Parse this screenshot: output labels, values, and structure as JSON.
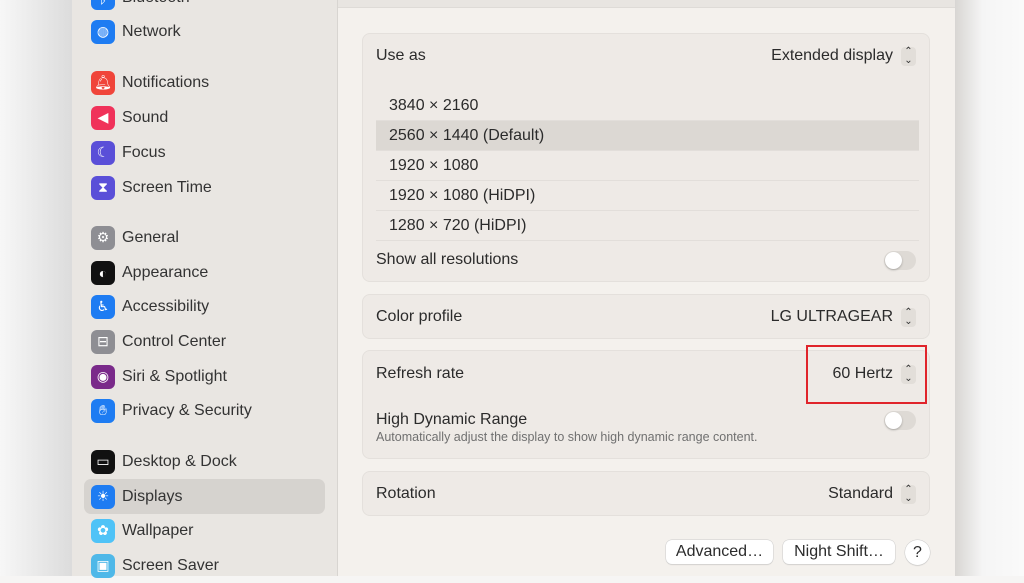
{
  "sidebar": {
    "items": [
      {
        "label": "Bluetooth",
        "icon": "bluetooth-icon",
        "color": "#1e7cf2"
      },
      {
        "label": "Network",
        "icon": "globe-icon",
        "color": "#1e7cf2"
      },
      {
        "label": "Notifications",
        "icon": "bell-icon",
        "color": "#f0453a"
      },
      {
        "label": "Sound",
        "icon": "speaker-icon",
        "color": "#f0325a"
      },
      {
        "label": "Focus",
        "icon": "moon-icon",
        "color": "#5a4fd8"
      },
      {
        "label": "Screen Time",
        "icon": "hourglass-icon",
        "color": "#5a4fd8"
      },
      {
        "label": "General",
        "icon": "gear-icon",
        "color": "#8e8e93"
      },
      {
        "label": "Appearance",
        "icon": "appearance-icon",
        "color": "#111111"
      },
      {
        "label": "Accessibility",
        "icon": "accessibility-icon",
        "color": "#1e7cf2"
      },
      {
        "label": "Control Center",
        "icon": "switches-icon",
        "color": "#8e8e93"
      },
      {
        "label": "Siri & Spotlight",
        "icon": "siri-icon",
        "color": "#7a2a8a"
      },
      {
        "label": "Privacy & Security",
        "icon": "hand-icon",
        "color": "#1e7cf2"
      },
      {
        "label": "Desktop & Dock",
        "icon": "dock-icon",
        "color": "#111111"
      },
      {
        "label": "Displays",
        "icon": "sun-icon",
        "color": "#1e7cf2",
        "selected": true
      },
      {
        "label": "Wallpaper",
        "icon": "flower-icon",
        "color": "#4fc3f7"
      },
      {
        "label": "Screen Saver",
        "icon": "screensaver-icon",
        "color": "#4fb8e8"
      }
    ]
  },
  "main": {
    "use_as": {
      "label": "Use as",
      "value": "Extended display"
    },
    "resolutions": [
      "3840 × 2160",
      "2560 × 1440 (Default)",
      "1920 × 1080",
      "1920 × 1080 (HiDPI)",
      "1280 × 720 (HiDPI)"
    ],
    "selected_resolution": "2560 × 1440 (Default)",
    "show_all": {
      "label": "Show all resolutions",
      "on": false
    },
    "color_profile": {
      "label": "Color profile",
      "value": "LG ULTRAGEAR"
    },
    "refresh_rate": {
      "label": "Refresh rate",
      "value": "60 Hertz"
    },
    "hdr": {
      "label": "High Dynamic Range",
      "description": "Automatically adjust the display to show high dynamic range content.",
      "on": false
    },
    "rotation": {
      "label": "Rotation",
      "value": "Standard"
    },
    "buttons": {
      "advanced": "Advanced…",
      "night_shift": "Night Shift…",
      "help": "?"
    }
  },
  "highlight_color": "#e0242b"
}
